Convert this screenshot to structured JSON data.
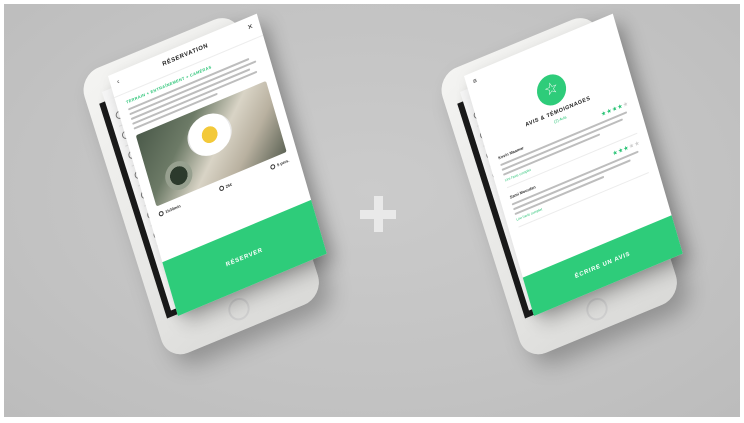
{
  "background_color": "#c4c4c4",
  "accent_color": "#2ecc7a",
  "separator": {
    "symbol": "+"
  },
  "left_mockup": {
    "header_title": "RÉSERVATION",
    "back_icon": "chevron-left-icon",
    "menu_icon": "close-icon",
    "subtitle": "TERRAIN + ENTRAÎNEMENT + CAMÉRAS",
    "meta": [
      {
        "icon": "clock-icon",
        "text": "1h30min"
      },
      {
        "icon": "wallet-icon",
        "text": "25€"
      },
      {
        "icon": "group-icon",
        "text": "5 pers."
      }
    ],
    "cta_label": "RÉSERVER"
  },
  "right_mockup": {
    "menu_icon": "hamburger-icon",
    "badge_icon": "star-icon",
    "title": "AVIS & TÉMOIGNAGES",
    "subtitle": "(2) Avis",
    "reviews": [
      {
        "author": "Kevin Maamar",
        "rating": 4,
        "more_label": "Lire l'avis complet"
      },
      {
        "author": "Sami Mourdan",
        "rating": 3,
        "more_label": "Lire l'avis complet"
      }
    ],
    "cta_label": "ÉCRIRE UN AVIS"
  }
}
